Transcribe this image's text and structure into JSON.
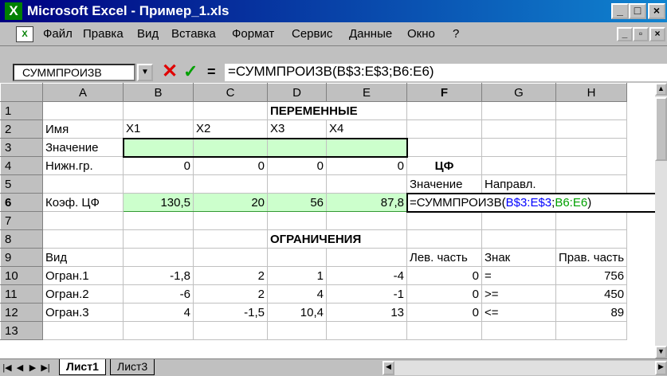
{
  "window": {
    "app_icon": "excel-x-icon",
    "app_icon_glyph": "X",
    "title": "Microsoft Excel - Пример_1.xls",
    "controls": [
      "_",
      "□",
      "×"
    ]
  },
  "menu": {
    "items": [
      {
        "label": "Файл"
      },
      {
        "label": "Правка"
      },
      {
        "label": "Вид"
      },
      {
        "label": "Вставка"
      },
      {
        "label": "Формат"
      },
      {
        "label": "Сервис"
      },
      {
        "label": "Данные"
      },
      {
        "label": "Окно"
      },
      {
        "label": "?"
      }
    ],
    "doc_controls": [
      "_",
      "▫",
      "×"
    ]
  },
  "formula_bar": {
    "name_box": "СУММПРОИЗВ",
    "cancel": "✕",
    "enter": "✓",
    "equals": "=",
    "content": "=СУММПРОИЗВ(B$3:E$3;B6:E6)"
  },
  "sheet": {
    "columns": [
      "A",
      "B",
      "C",
      "D",
      "E",
      "F",
      "G",
      "H"
    ],
    "rows": [
      "1",
      "2",
      "3",
      "4",
      "5",
      "6",
      "7",
      "8",
      "9",
      "10",
      "11",
      "12",
      "13"
    ],
    "cells": {
      "D1": "ПЕРЕМЕННЫЕ",
      "A2": "Имя",
      "B2": "X1",
      "C2": "X2",
      "D2": "X3",
      "E2": "X4",
      "A3": "Значение",
      "A4": "Нижн.гр.",
      "B4": "0",
      "C4": "0",
      "D4": "0",
      "E4": "0",
      "F4": "ЦФ",
      "F5": "Значение",
      "G5": "Направл.",
      "A6": "Коэф. ЦФ",
      "B6": "130,5",
      "C6": "20",
      "D6": "56",
      "E6": "87,8",
      "F6_prefix": "=СУММПРОИЗВ(",
      "F6_ref1": "B$3:E$3",
      "F6_sep": ";",
      "F6_ref2": "B6:E6",
      "F6_suffix": ")",
      "D8": "ОГРАНИЧЕНИЯ",
      "A9": "Вид",
      "F9": "Лев. часть",
      "G9": "Знак",
      "H9": "Прав. часть",
      "A10": "Огран.1",
      "B10": "-1,8",
      "C10": "2",
      "D10": "1",
      "E10": "-4",
      "F10": "0",
      "G10": "=",
      "H10": "756",
      "A11": "Огран.2",
      "B11": "-6",
      "C11": "2",
      "D11": "4",
      "E11": "-1",
      "F11": "0",
      "G11": ">=",
      "H11": "450",
      "A12": "Огран.3",
      "B12": "4",
      "C12": "-1,5",
      "D12": "10,4",
      "E12": "13",
      "F12": "0",
      "G12": "<=",
      "H12": "89"
    },
    "colors": {
      "highlight": "#ccffcc",
      "ref1": "#0000ff",
      "ref2": "#00a000"
    }
  },
  "tabs": {
    "nav": [
      "|◀",
      "◀",
      "▶",
      "▶|"
    ],
    "sheets": [
      {
        "label": "Лист1",
        "active": true
      },
      {
        "label": "Лист3",
        "active": false
      }
    ]
  }
}
